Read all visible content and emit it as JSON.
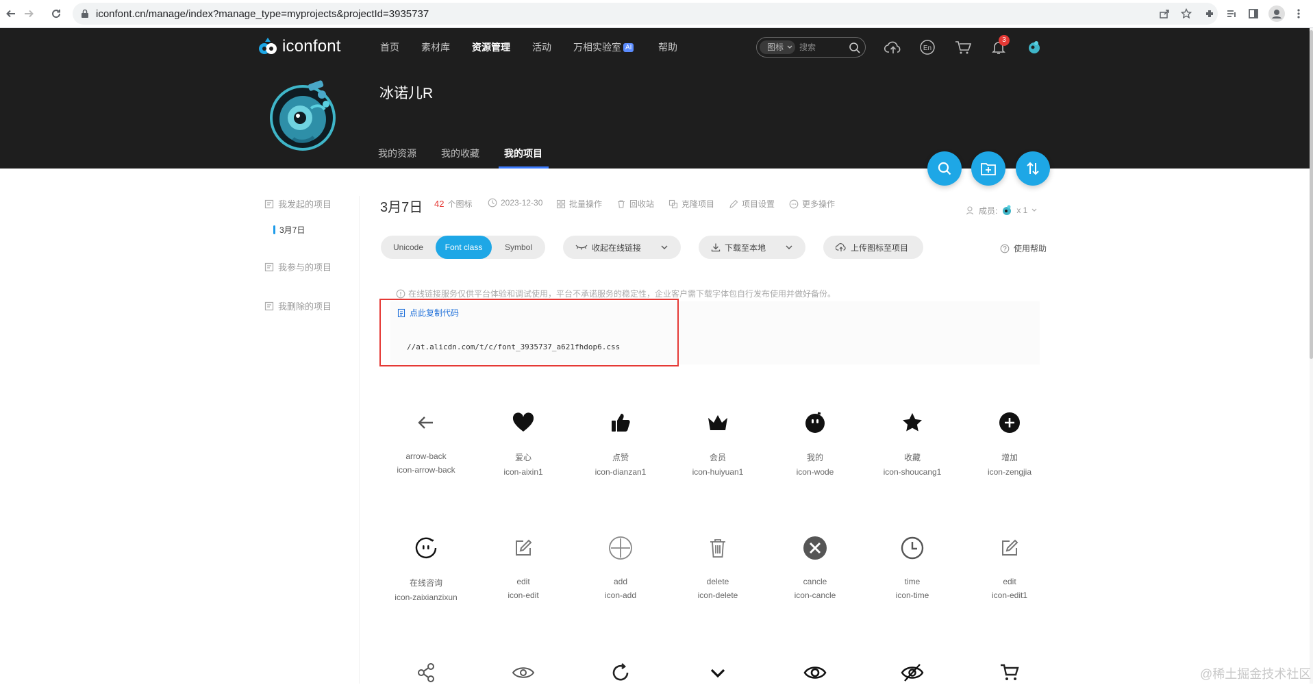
{
  "browser": {
    "url": "iconfont.cn/manage/index?manage_type=myprojects&projectId=3935737"
  },
  "header": {
    "brand": "iconfont",
    "nav": [
      {
        "label": "首页"
      },
      {
        "label": "素材库"
      },
      {
        "label": "资源管理"
      },
      {
        "label": "活动"
      },
      {
        "label": "万相实验室"
      },
      {
        "label": "帮助"
      }
    ],
    "ai_badge": "AI",
    "search_type": "图标",
    "search_placeholder": "搜索",
    "notification_count": "3"
  },
  "profile": {
    "user_name": "冰诺儿R",
    "tabs": [
      {
        "label": "我的资源"
      },
      {
        "label": "我的收藏"
      },
      {
        "label": "我的项目"
      }
    ]
  },
  "sidebar": {
    "items": [
      {
        "label": "我发起的项目"
      },
      {
        "label": "我参与的项目"
      },
      {
        "label": "我删除的项目"
      }
    ],
    "sub_item": "3月7日"
  },
  "project": {
    "title": "3月7日",
    "icon_count": "42",
    "icon_count_unit": "个图标",
    "date": "2023-12-30",
    "actions": [
      {
        "label": "批量操作"
      },
      {
        "label": "回收站"
      },
      {
        "label": "克隆项目"
      },
      {
        "label": "项目设置"
      },
      {
        "label": "更多操作"
      }
    ],
    "members_label": "成员:",
    "members_count": "x 1"
  },
  "toolbar": {
    "formats": [
      {
        "label": "Unicode"
      },
      {
        "label": "Font class"
      },
      {
        "label": "Symbol"
      }
    ],
    "collapse_link": "收起在线链接",
    "download": "下载至本地",
    "upload": "上传图标至项目",
    "help": "使用帮助"
  },
  "notice": "在线链接服务仅供平台体验和调试使用，平台不承诺服务的稳定性，企业客户需下载字体包自行发布使用并做好备份。",
  "copy_code": "点此复制代码",
  "css_url": "//at.alicdn.com/t/c/font_3935737_a621fhdop6.css",
  "icons_row1": [
    {
      "name": "arrow-back",
      "class": "icon-arrow-back",
      "icon": "arrow-back-icon"
    },
    {
      "name": "爱心",
      "class": "icon-aixin1",
      "icon": "heart-icon"
    },
    {
      "name": "点赞",
      "class": "icon-dianzan1",
      "icon": "thumbs-up-icon"
    },
    {
      "name": "会员",
      "class": "icon-huiyuan1",
      "icon": "crown-icon"
    },
    {
      "name": "我的",
      "class": "icon-wode",
      "icon": "face-icon"
    },
    {
      "name": "收藏",
      "class": "icon-shoucang1",
      "icon": "star-icon"
    },
    {
      "name": "增加",
      "class": "icon-zengjia",
      "icon": "plus-circle-icon"
    }
  ],
  "icons_row2": [
    {
      "name": "在线咨询",
      "class": "icon-zaixianzixun",
      "icon": "chat-face-icon"
    },
    {
      "name": "edit",
      "class": "icon-edit",
      "icon": "edit-icon"
    },
    {
      "name": "add",
      "class": "icon-add",
      "icon": "add-circle-icon"
    },
    {
      "name": "delete",
      "class": "icon-delete",
      "icon": "trash-icon"
    },
    {
      "name": "cancle",
      "class": "icon-cancle",
      "icon": "cancel-circle-icon"
    },
    {
      "name": "time",
      "class": "icon-time",
      "icon": "clock-icon"
    },
    {
      "name": "edit",
      "class": "icon-edit1",
      "icon": "edit-icon"
    }
  ],
  "icons_row3": [
    {
      "icon": "share-icon"
    },
    {
      "icon": "eye-icon"
    },
    {
      "icon": "refresh-icon"
    },
    {
      "icon": "chevron-down-icon"
    },
    {
      "icon": "eye-bold-icon"
    },
    {
      "icon": "eye-off-icon"
    },
    {
      "icon": "cart-icon"
    }
  ],
  "watermark": "@稀土掘金技术社区",
  "colors": {
    "accent": "#1ea7e6",
    "header_bg": "#1e1e1e",
    "highlight": "#e53935",
    "link": "#1e6fd9"
  }
}
